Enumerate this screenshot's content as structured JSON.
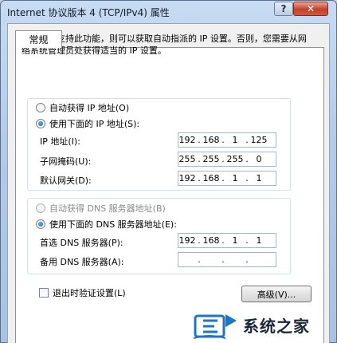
{
  "window": {
    "title": "Internet 协议版本 4 (TCP/IPv4) 属性",
    "help_label": "?",
    "close_label": "✕"
  },
  "tabs": [
    {
      "label": "常规"
    }
  ],
  "description": "如果网络支持此功能，则可以获取自动指派的 IP 设置。否则，您需要从网络系统管理员处获得适当的 IP 设置。",
  "ip_settings": {
    "auto_label": "自动获得 IP 地址(O)",
    "manual_label": "使用下面的 IP 地址(S):",
    "selected": "manual",
    "fields": [
      {
        "label": "IP 地址(I):",
        "octets": [
          "192",
          "168",
          "1",
          "125"
        ]
      },
      {
        "label": "子网掩码(U):",
        "octets": [
          "255",
          "255",
          "255",
          "0"
        ]
      },
      {
        "label": "默认网关(D):",
        "octets": [
          "192",
          "168",
          "1",
          "1"
        ]
      }
    ]
  },
  "dns_settings": {
    "auto_label": "自动获得 DNS 服务器地址(B)",
    "manual_label": "使用下面的 DNS 服务器地址(E):",
    "selected": "manual",
    "fields": [
      {
        "label": "首选 DNS 服务器(P):",
        "octets": [
          "192",
          "168",
          "1",
          "1"
        ]
      },
      {
        "label": "备用 DNS 服务器(A):",
        "octets": [
          "",
          "",
          "",
          ""
        ]
      }
    ]
  },
  "validate_on_exit": {
    "label": "退出时验证设置(L)",
    "checked": false
  },
  "advanced_button": "高级(V)...",
  "watermark": {
    "text": "系统之家"
  }
}
